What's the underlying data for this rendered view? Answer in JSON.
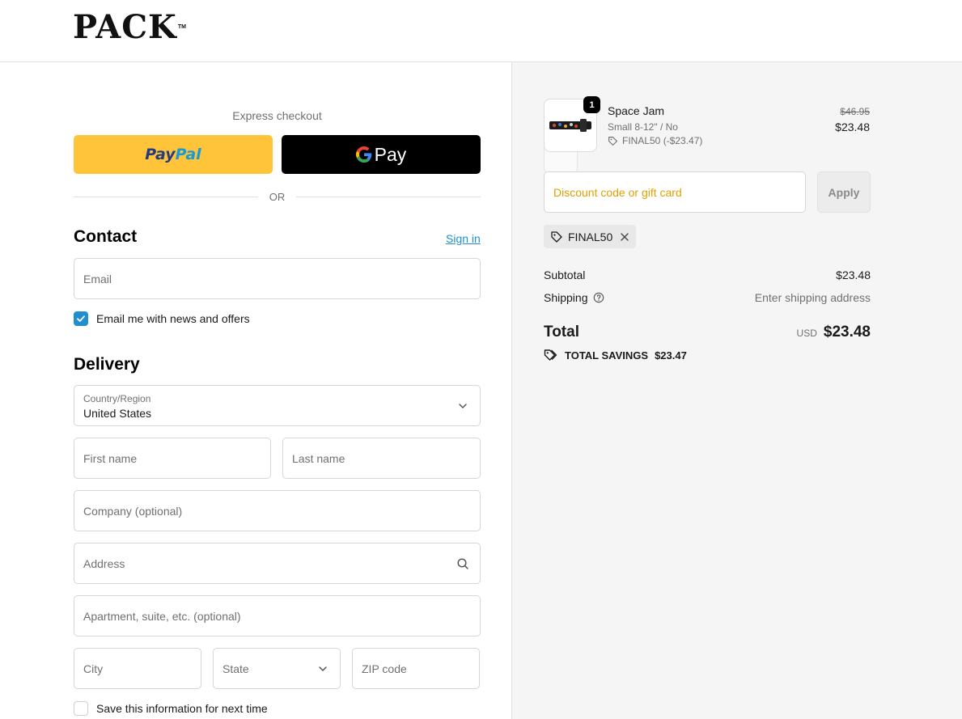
{
  "brand": {
    "logo_text": "PACK",
    "trademark": "TM"
  },
  "express": {
    "title": "Express checkout",
    "paypal_label_part1": "Pay",
    "paypal_label_part2": "Pal",
    "gpay_label": "Pay",
    "divider": "OR"
  },
  "contact": {
    "title": "Contact",
    "signin_label": "Sign in",
    "email_placeholder": "Email",
    "newsletter_label": "Email me with news and offers",
    "newsletter_checked": true
  },
  "delivery": {
    "title": "Delivery",
    "country_label": "Country/Region",
    "country_value": "United States",
    "first_name_placeholder": "First name",
    "last_name_placeholder": "Last name",
    "company_placeholder": "Company (optional)",
    "address_placeholder": "Address",
    "apartment_placeholder": "Apartment, suite, etc. (optional)",
    "city_placeholder": "City",
    "state_value": "State",
    "zip_placeholder": "ZIP code",
    "save_info_label": "Save this information for next time",
    "save_info_checked": false
  },
  "cart": {
    "item": {
      "quantity": "1",
      "name": "Space Jam",
      "variant": "Small 8-12\" / No",
      "discount": "FINAL50 (-$23.47)",
      "original_price": "$46.95",
      "price": "$23.48"
    },
    "discount_placeholder": "Discount code or gift card",
    "apply_label": "Apply",
    "applied_code": "FINAL50",
    "subtotal_label": "Subtotal",
    "subtotal_value": "$23.48",
    "shipping_label": "Shipping",
    "shipping_value": "Enter shipping address",
    "total_label": "Total",
    "currency": "USD",
    "total_value": "$23.48",
    "savings_label": "TOTAL SAVINGS",
    "savings_value": "$23.47"
  },
  "colors": {
    "accent_link": "#1f8fd1",
    "paypal_yellow": "#ffc439",
    "discount_placeholder": "#e0a100",
    "summary_bg": "#f5f5f5"
  },
  "icons": [
    "google-g-icon",
    "chevron-down-icon",
    "search-icon",
    "check-icon",
    "tag-icon",
    "close-icon",
    "help-circle-icon",
    "savings-tag-icon"
  ]
}
